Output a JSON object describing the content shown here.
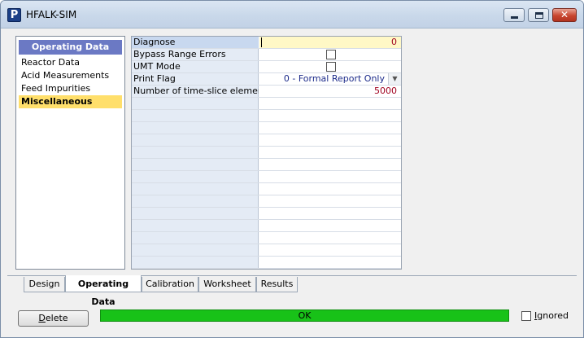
{
  "window": {
    "title": "HFALK-SIM",
    "icon": "P",
    "close_glyph": "✕"
  },
  "nav": {
    "header": "Operating Data",
    "items": [
      {
        "label": "Reactor Data",
        "selected": false
      },
      {
        "label": "Acid Measurements",
        "selected": false
      },
      {
        "label": "Feed Impurities",
        "selected": false
      },
      {
        "label": "Miscellaneous",
        "selected": true
      }
    ]
  },
  "grid": {
    "rows": [
      {
        "label": "Diagnose",
        "value": "0",
        "kind": "number-editing"
      },
      {
        "label": "Bypass Range Errors",
        "value": "",
        "kind": "checkbox",
        "checked": false
      },
      {
        "label": "UMT Mode",
        "value": "",
        "kind": "checkbox",
        "checked": false
      },
      {
        "label": "Print Flag",
        "value": "0 - Formal Report Only",
        "kind": "select"
      },
      {
        "label": "Number of time-slice elements",
        "value": "5000",
        "kind": "number"
      }
    ],
    "dropdown_arrow": "▼"
  },
  "tabs": [
    {
      "label": "Design",
      "active": false
    },
    {
      "label": "Operating Data",
      "active": true
    },
    {
      "label": "Calibration",
      "active": false
    },
    {
      "label": "Worksheet",
      "active": false
    },
    {
      "label": "Results",
      "active": false
    }
  ],
  "footer": {
    "delete_first": "D",
    "delete_rest": "elete",
    "status": "OK",
    "ignored_first": "I",
    "ignored_rest": "gnored",
    "ignored_checked": false
  },
  "colors": {
    "nav_header": "#6b79c4",
    "nav_selected": "#ffdf6b",
    "status_ok": "#18c218",
    "value_text": "#a0001e",
    "select_text": "#1b2a8a"
  }
}
